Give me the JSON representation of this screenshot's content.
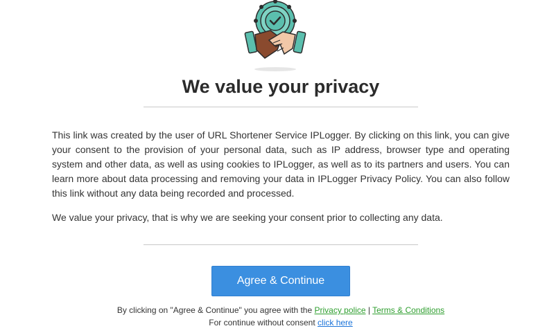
{
  "title": "We value your privacy",
  "paragraph1": "This link was created by the user of URL Shortener Service IPLogger. By clicking on this link, you can give your consent to the provision of your personal data, such as IP address, browser type and operating system and other data, as well as using cookies to IPLogger, as well as to its partners and users. You can learn more about data processing and removing your data in IPLogger Privacy Policy. You can also follow this link without any data being recorded and processed.",
  "paragraph2": "We value your privacy, that is why we are seeking your consent prior to collecting any data.",
  "agree_button": "Agree & Continue",
  "footer": {
    "line1_prefix": "By clicking on \"Agree & Continue\" you agree with the",
    "privacy_link": "Privacy police",
    "separator": "|",
    "terms_link": "Terms & Conditions",
    "line2_prefix": "For continue without consent",
    "click_here_link": "click here"
  },
  "icons": {
    "hero": "handshake-badge-icon"
  },
  "colors": {
    "button": "#3b8fe0",
    "link_green": "#2e9e2e",
    "link_blue": "#1a73d9",
    "badge": "#5bbfae"
  }
}
